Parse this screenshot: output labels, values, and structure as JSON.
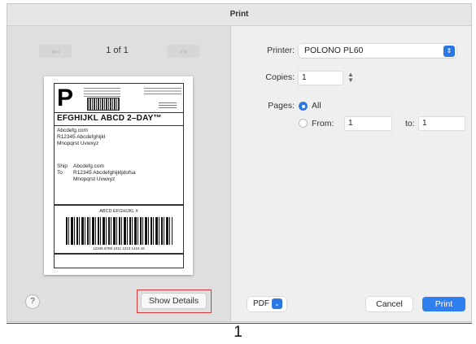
{
  "window": {
    "title": "Print"
  },
  "preview": {
    "prev_buttons": "«‹ ‹",
    "next_buttons": "› ››",
    "page_count": "1 of 1",
    "label": {
      "service_letter": "P",
      "service_line": "EFGHIJKL ABCD 2–DAY™",
      "sender_lines": [
        "Abcdefg.com",
        "R12345 Abcdefghijkl",
        "Mnopqrst Uvwxyz"
      ],
      "ship_to_prefix": [
        "Ship",
        "To"
      ],
      "ship_to_lines": [
        "Abcdefg.com",
        "R12345 Abcdefghijkljdofsa",
        "Mnopqrst Uvwxyz"
      ],
      "tracking_label": "ABCD EFGHIJKL #",
      "tracking_number": "12345 6789 1011 1213 1415 16"
    },
    "help_label": "?",
    "show_details_label": "Show Details"
  },
  "settings": {
    "printer_label": "Printer:",
    "printer_value": "POLONO PL60",
    "copies_label": "Copies:",
    "copies_value": "1",
    "pages_label": "Pages:",
    "pages_all_label": "All",
    "pages_from_label": "From:",
    "pages_from_value": "1",
    "pages_to_label": "to:",
    "pages_to_value": "1"
  },
  "footer_bar": {
    "pdf_label": "PDF",
    "cancel_label": "Cancel",
    "print_label": "Print"
  },
  "caption": {
    "number": "1"
  },
  "colors": {
    "accent": "#2b78e4",
    "highlight_box": "#d8393b"
  },
  "icons": {
    "printer_dropdown": "chevron-updown-icon",
    "copies_stepper": "stepper-icon",
    "pdf_dropdown": "chevron-down-icon",
    "help": "question-icon"
  }
}
